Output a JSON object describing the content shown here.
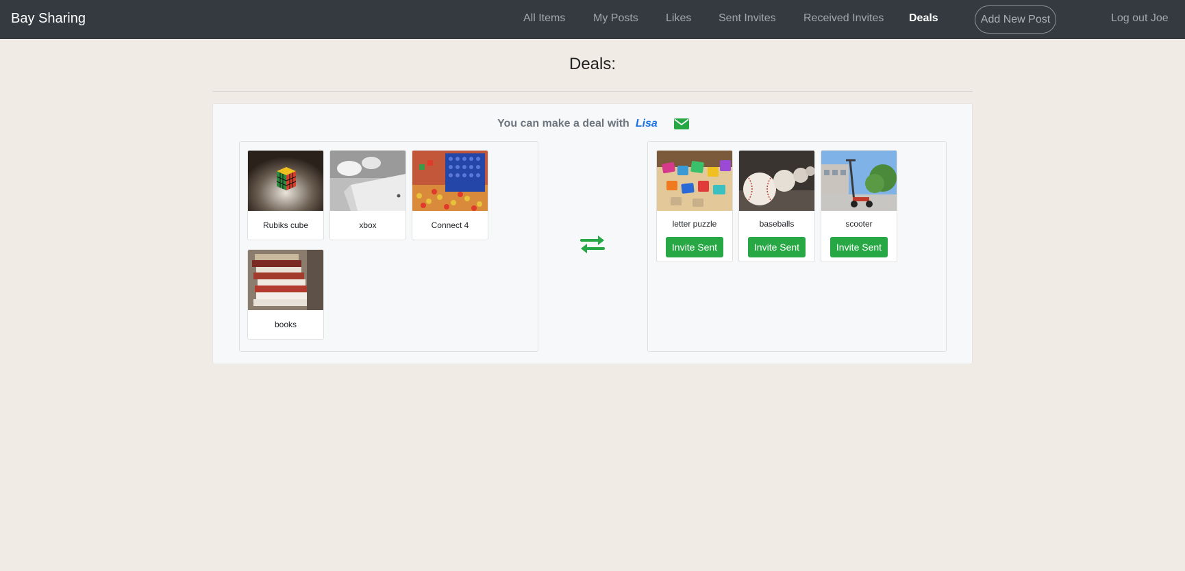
{
  "nav": {
    "brand": "Bay Sharing",
    "links": [
      {
        "label": "All Items"
      },
      {
        "label": "My Posts"
      },
      {
        "label": "Likes"
      },
      {
        "label": "Sent Invites"
      },
      {
        "label": "Received Invites"
      },
      {
        "label": "Deals",
        "active": true
      }
    ],
    "add_post": "Add New Post",
    "logout": "Log out Joe"
  },
  "page": {
    "title": "Deals:"
  },
  "deal": {
    "prefix": "You can make a deal with",
    "partner": "Lisa",
    "mail_icon": "envelope-icon",
    "swap_icon": "exchange-arrows-icon",
    "my_items": [
      {
        "name": "Rubiks cube"
      },
      {
        "name": "xbox"
      },
      {
        "name": "Connect 4"
      },
      {
        "name": "books"
      }
    ],
    "their_items": [
      {
        "name": "letter puzzle",
        "button": "Invite Sent"
      },
      {
        "name": "baseballs",
        "button": "Invite Sent"
      },
      {
        "name": "scooter",
        "button": "Invite Sent"
      }
    ]
  },
  "colors": {
    "navbar": "#343a40",
    "background": "#f0ebe5",
    "accent_green": "#28a745",
    "partner_blue": "#1a73e8"
  }
}
